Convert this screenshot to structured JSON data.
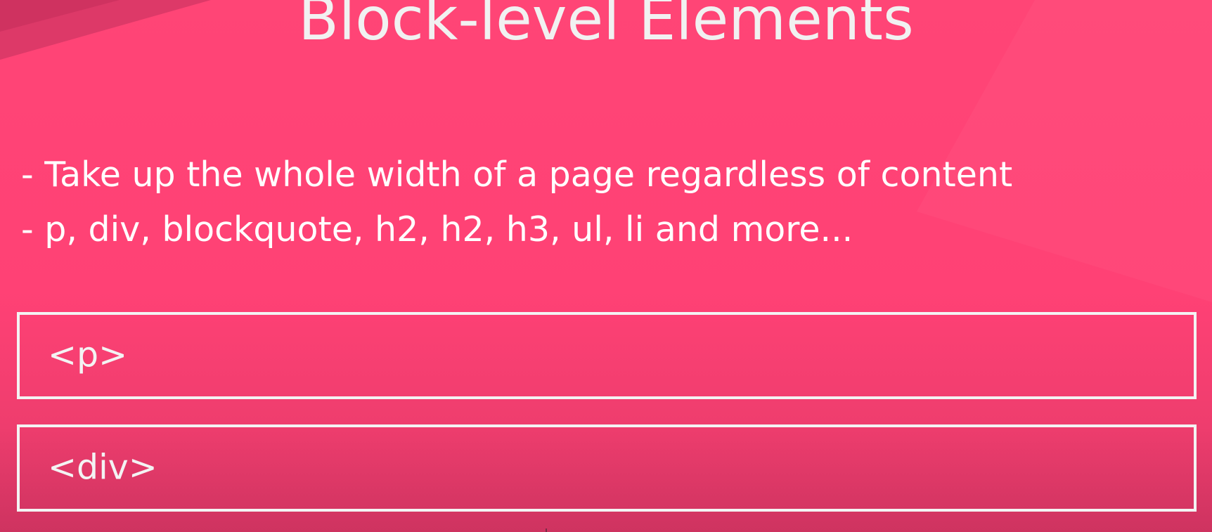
{
  "slide": {
    "title": "Block-level Elements",
    "bullets": [
      "- Take up the whole width of a page regardless of content",
      "- p, div, blockquote, h2, h2, h3, ul, li and more..."
    ],
    "boxes": [
      {
        "label": "<p>"
      },
      {
        "label": "<div>"
      }
    ]
  },
  "colors": {
    "background": "#ff4175",
    "text": "#ffffff",
    "box_border": "#f3f3f3"
  }
}
